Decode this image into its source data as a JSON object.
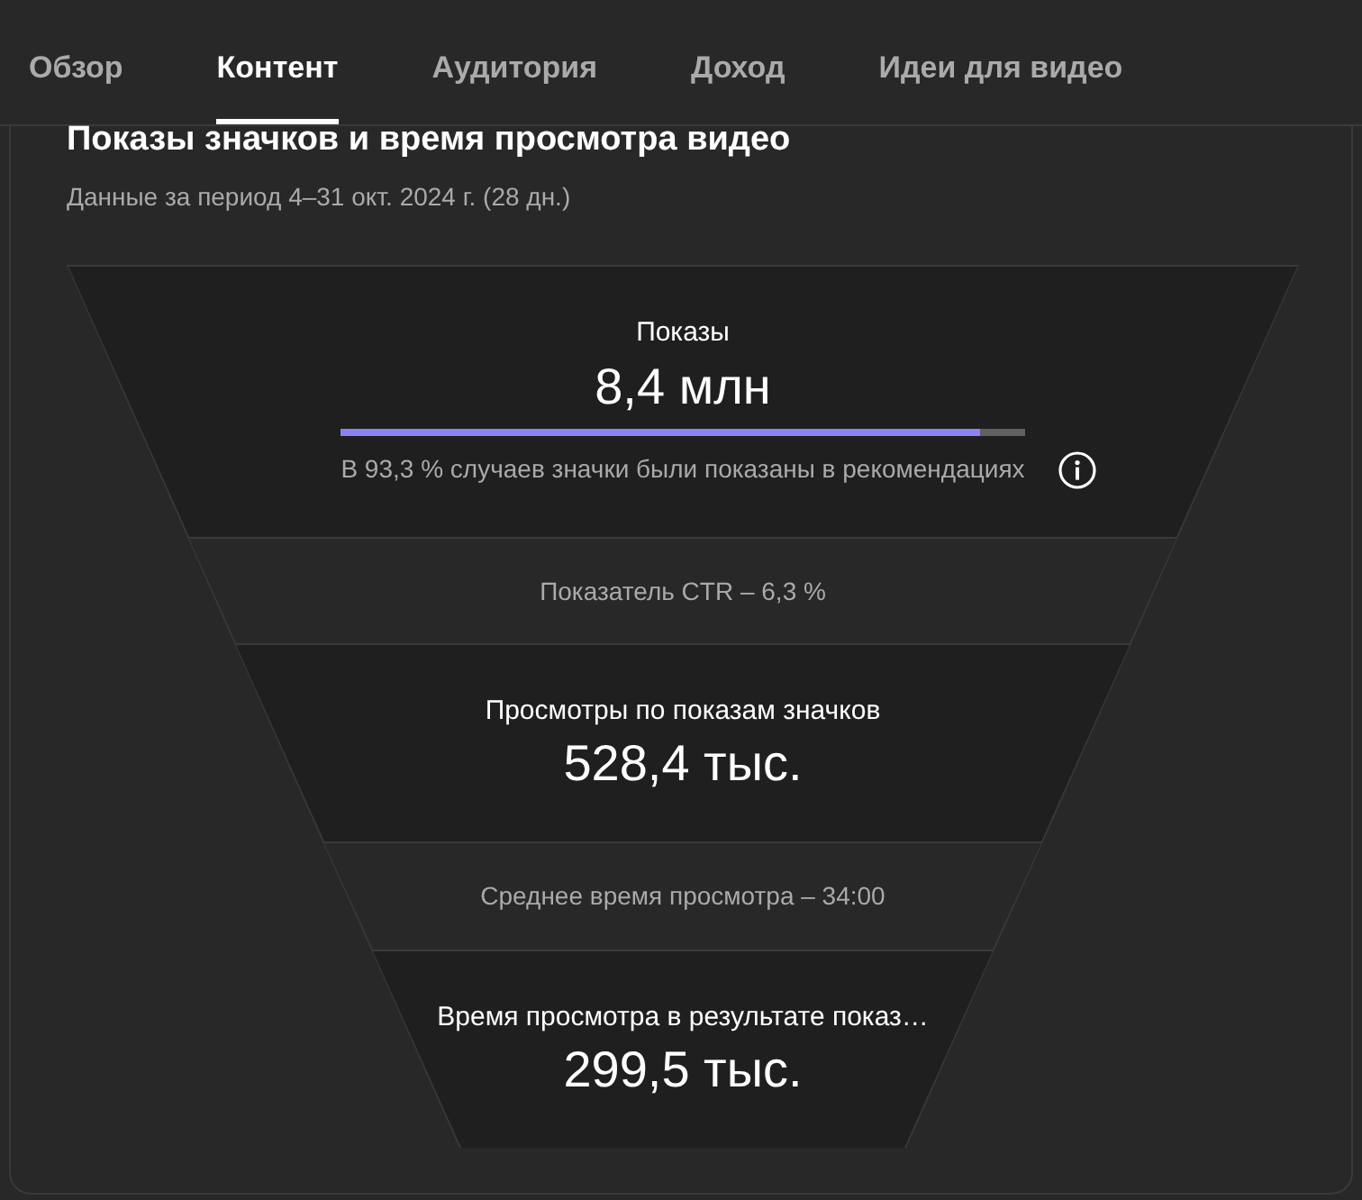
{
  "tabs": [
    {
      "label": "Обзор",
      "selected": false
    },
    {
      "label": "Контент",
      "selected": true
    },
    {
      "label": "Аудитория",
      "selected": false
    },
    {
      "label": "Доход",
      "selected": false
    },
    {
      "label": "Идеи для видео",
      "selected": false
    }
  ],
  "card": {
    "title": "Показы значков и время просмотра видео",
    "subtitle": "Данные за период 4–31 окт. 2024 г. (28 дн.)"
  },
  "funnel": [
    {
      "kind": "stage",
      "label": "Показы",
      "value": "8,4 млн",
      "level": 0.934,
      "note": "В 93,3 % случаев значки были показаны в рекомендациях"
    },
    {
      "kind": "rate",
      "label": "Показатель CTR – 6,3 %"
    },
    {
      "kind": "stage",
      "label": "Просмотры по показам значков",
      "value": "528,4 тыс."
    },
    {
      "kind": "rate",
      "label": "Среднее время просмотра – 34:00"
    },
    {
      "kind": "stage",
      "label": "Время просмотра в результате показ…",
      "value": "299,5 тыс."
    }
  ]
}
